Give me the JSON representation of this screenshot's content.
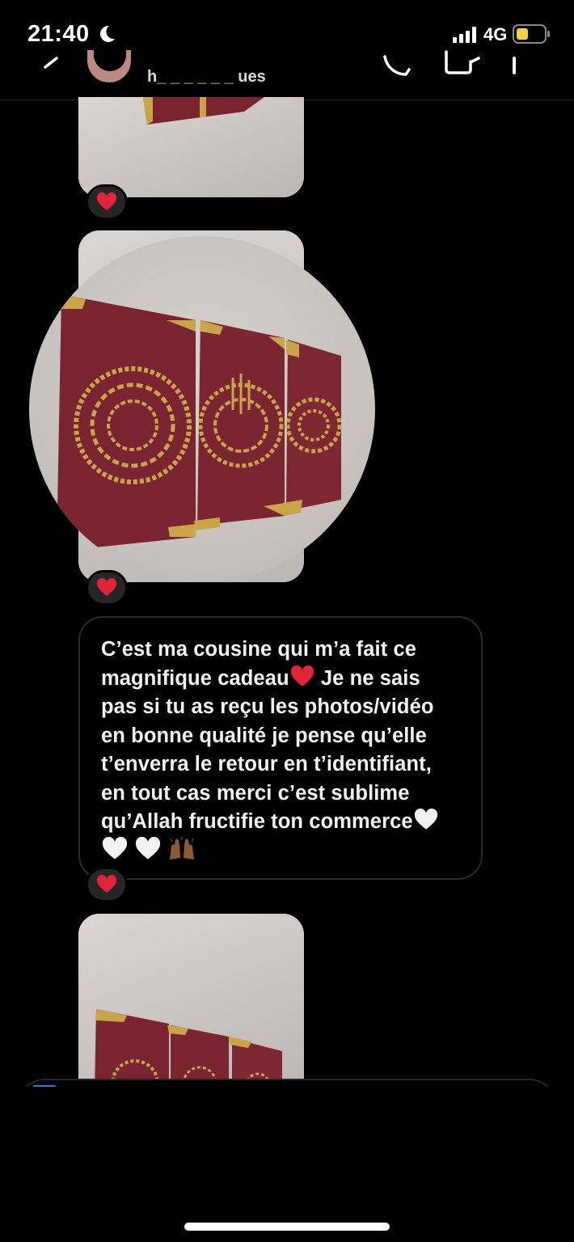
{
  "status_bar": {
    "time": "21:40",
    "network": "4G",
    "icons": [
      "moon-icon",
      "signal-icon",
      "battery-icon"
    ],
    "battery_color": "#f2d23c"
  },
  "header": {
    "username": "h_ _ _ _ _ _ ues",
    "icons": [
      "back-icon",
      "call-icon",
      "video-icon",
      "info-icon"
    ]
  },
  "messages": [
    {
      "type": "photo",
      "reaction": "❤️"
    },
    {
      "type": "photo",
      "reaction": "❤️"
    },
    {
      "type": "text",
      "lines": [
        "C’est ma cousine qui m’a fait ce",
        "magnifique cadeau",
        "pas si tu as reçu les photos/vidéo",
        "en bonne qualité je pense qu’elle",
        "t’enverra le retour en t’identifiant,",
        "en tout cas merci c’est sublime",
        "qu’Allah fructifie ton commerce"
      ],
      "line2_suffix": " Je ne sais",
      "reaction": "❤️"
    },
    {
      "type": "photo"
    }
  ],
  "colors": {
    "background": "#000000",
    "bubble_border": "#2a2a2a",
    "canvas_red": "#7a2431",
    "gold": "#c9a449",
    "heart": "#e0243a"
  }
}
